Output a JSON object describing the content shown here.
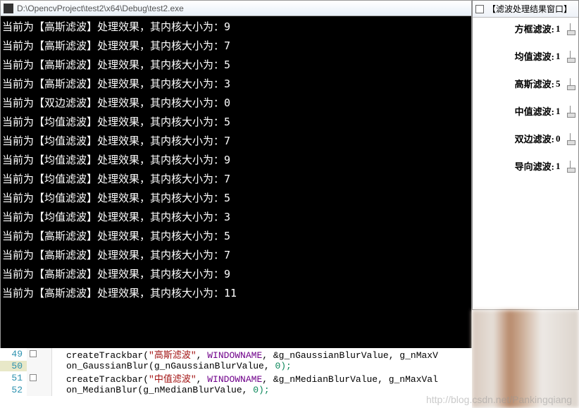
{
  "console": {
    "title": "D:\\OpencvProject\\test2\\x64\\Debug\\test2.exe",
    "lines": [
      "当前为【高斯滤波】处理效果，其内核大小为：9",
      "当前为【高斯滤波】处理效果，其内核大小为：7",
      "当前为【高斯滤波】处理效果，其内核大小为：5",
      "当前为【高斯滤波】处理效果，其内核大小为：3",
      "当前为【双边滤波】处理效果，其内核大小为：0",
      "当前为【均值滤波】处理效果，其内核大小为：5",
      "当前为【均值滤波】处理效果，其内核大小为：7",
      "当前为【均值滤波】处理效果，其内核大小为：9",
      "当前为【均值滤波】处理效果，其内核大小为：7",
      "当前为【均值滤波】处理效果，其内核大小为：5",
      "当前为【均值滤波】处理效果，其内核大小为：3",
      "当前为【高斯滤波】处理效果，其内核大小为：5",
      "当前为【高斯滤波】处理效果，其内核大小为：7",
      "当前为【高斯滤波】处理效果，其内核大小为：9",
      "当前为【高斯滤波】处理效果，其内核大小为：11"
    ]
  },
  "result_window": {
    "title": "【滤波处理结果窗口】",
    "sliders": [
      {
        "label": "方框滤波:",
        "value": "1"
      },
      {
        "label": "均值滤波:",
        "value": "1"
      },
      {
        "label": "高斯滤波:",
        "value": "5"
      },
      {
        "label": "中值滤波:",
        "value": "1"
      },
      {
        "label": "双边滤波:",
        "value": "0"
      },
      {
        "label": "导向滤波:",
        "value": "1"
      }
    ]
  },
  "code": {
    "lines": [
      {
        "n": "49",
        "pre": "createTrackbar(",
        "str": "\"高斯滤波\"",
        "mid": ", ",
        "macro": "WINDOWNAME",
        "post": ", &g_nGaussianBlurValue, g_nMaxV"
      },
      {
        "n": "50",
        "pre": "on_GaussianBlur(g_nGaussianBlurValue, ",
        "str": "",
        "mid": "",
        "macro": "",
        "post": "0);"
      },
      {
        "n": "51",
        "pre": "createTrackbar(",
        "str": "\"中值滤波\"",
        "mid": ", ",
        "macro": "WINDOWNAME",
        "post": ", &g_nMedianBlurValue, g_nMaxVal"
      },
      {
        "n": "52",
        "pre": "on_MedianBlur(g_nMedianBlurValue, ",
        "str": "",
        "mid": "",
        "macro": "",
        "post": "0);"
      }
    ]
  },
  "watermark": "http://blog.csdn.net/Pankingqiang"
}
